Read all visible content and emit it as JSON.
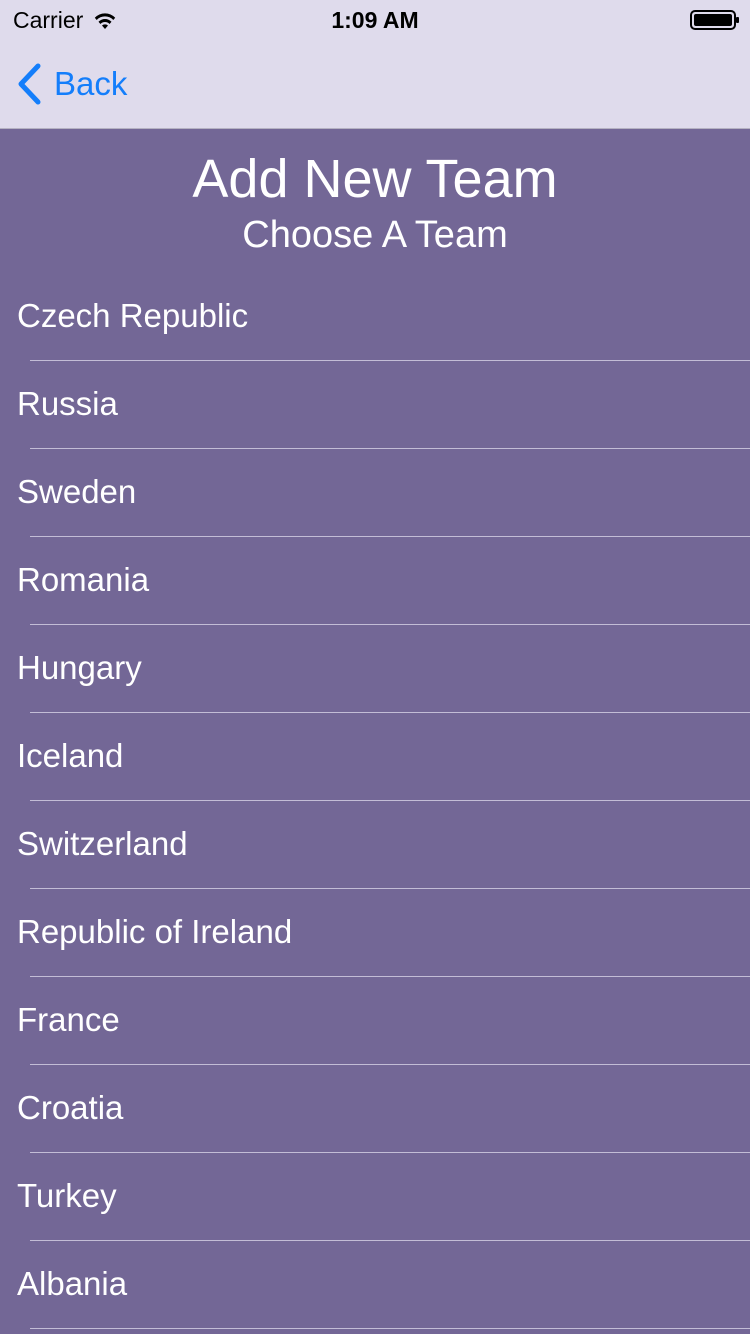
{
  "status_bar": {
    "carrier": "Carrier",
    "time": "1:09 AM",
    "icons": [
      "wifi-icon",
      "battery-icon"
    ]
  },
  "nav": {
    "back_label": "Back",
    "back_icon": "chevron-left-icon",
    "tint_color": "#147efb",
    "background": "#dfdbec"
  },
  "header": {
    "title": "Add New Team",
    "subtitle": "Choose A Team"
  },
  "theme": {
    "list_background": "#736796",
    "text_color": "#ffffff",
    "separator_color": "#c3bdd6"
  },
  "teams": [
    "Czech Republic",
    "Russia",
    "Sweden",
    "Romania",
    "Hungary",
    "Iceland",
    "Switzerland",
    "Republic of Ireland",
    "France",
    "Croatia",
    "Turkey",
    "Albania"
  ]
}
